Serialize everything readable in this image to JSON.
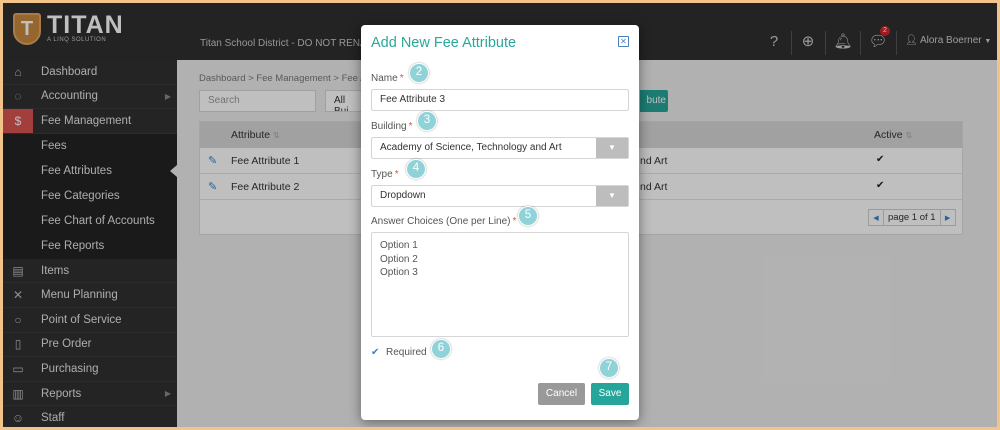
{
  "app": {
    "brand": "TITAN",
    "tagline": "A LINQ SOLUTION",
    "logo_letter": "T",
    "district": "Titan School District - DO NOT RENA",
    "notifications_count": "2",
    "user_name": "Alora Boerner"
  },
  "sidebar": {
    "items": [
      {
        "label": "Dashboard",
        "icon": "home-icon"
      },
      {
        "label": "Accounting",
        "icon": "piggy-bank-icon"
      },
      {
        "label": "Fee Management",
        "icon": "dollar-icon"
      },
      {
        "label": "Items",
        "icon": "clipboard-icon"
      },
      {
        "label": "Menu Planning",
        "icon": "utensils-icon"
      },
      {
        "label": "Point of Service",
        "icon": "apple-icon"
      },
      {
        "label": "Pre Order",
        "icon": "document-icon"
      },
      {
        "label": "Purchasing",
        "icon": "box-icon"
      },
      {
        "label": "Reports",
        "icon": "report-icon"
      },
      {
        "label": "Staff",
        "icon": "people-icon"
      }
    ],
    "fee_sub": [
      "Fees",
      "Fee Attributes",
      "Fee Categories",
      "Fee Chart of Accounts",
      "Fee Reports"
    ]
  },
  "main": {
    "breadcrumb": "Dashboard  >  Fee Management  >  Fee A",
    "search_placeholder": "Search",
    "building_filter": "All Bui",
    "add_button_tail": "bute",
    "columns": {
      "attribute": "Attribute",
      "active": "Active"
    },
    "rows": [
      {
        "attribute": "Fee Attribute 1",
        "building_tail": "nd Art",
        "active": "✔"
      },
      {
        "attribute": "Fee Attribute 2",
        "building_tail": "nd Art",
        "active": "✔"
      }
    ],
    "pager": "page 1 of 1"
  },
  "modal": {
    "title": "Add New Fee Attribute",
    "name_label": "Name",
    "name_value": "Fee Attribute 3",
    "building_label": "Building",
    "building_value": "Academy of Science, Technology and Art",
    "type_label": "Type",
    "type_value": "Dropdown",
    "choices_label": "Answer Choices (One per Line)",
    "choices": [
      "Option 1",
      "Option 2",
      "Option 3"
    ],
    "required_label": "Required",
    "required_mark": "*",
    "cancel": "Cancel",
    "save": "Save"
  },
  "steps": [
    "2",
    "3",
    "4",
    "5",
    "6",
    "7"
  ],
  "colors": {
    "accent": "#26a69a",
    "danger": "#d9534f",
    "sidebar": "#303030",
    "topbar": "#2f2f2f"
  }
}
